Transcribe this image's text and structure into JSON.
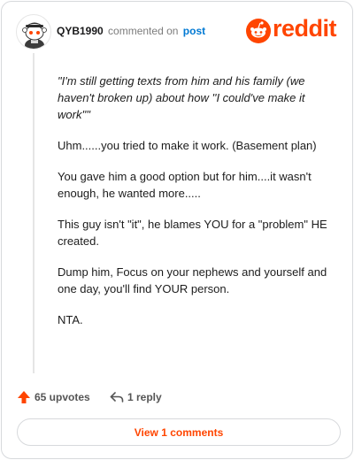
{
  "comment": {
    "username": "QYB1990",
    "commented_on": "commented on",
    "post_link": "post",
    "paragraphs": [
      "\"I'm still getting texts from him and his family (we haven't broken up) about how ''I could've make it work''\"",
      "Uhm......you tried to make it work. (Basement plan)",
      "You gave him a good option but for him....it wasn't enough, he wanted more.....",
      "This guy isn't \"it\", he blames YOU for a \"problem\" HE created.",
      "Dump him, Focus on your nephews and yourself and one day, you'll find YOUR person.",
      "NTA."
    ]
  },
  "brand": {
    "logo_text": "reddit",
    "accent_color": "#ff4500"
  },
  "actions": {
    "upvotes": "65 upvotes",
    "replies": "1 reply",
    "view_comments": "View 1 comments"
  },
  "icons": {
    "avatar": "snoo-avatar-icon",
    "logo": "reddit-snoo-icon",
    "upvote": "upvote-arrow-icon",
    "reply": "reply-arrow-icon"
  }
}
